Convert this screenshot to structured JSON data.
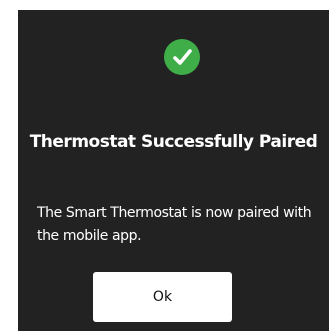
{
  "dialog": {
    "icon": "check-circle-icon",
    "title": "Thermostat Successfully Paired",
    "message": "The Smart Thermostat is now paired with the mobile app.",
    "ok_label": "Ok"
  },
  "colors": {
    "dialog_background": "#222222",
    "success_green": "#3fae49",
    "button_background": "#ffffff",
    "text": "#ffffff"
  }
}
